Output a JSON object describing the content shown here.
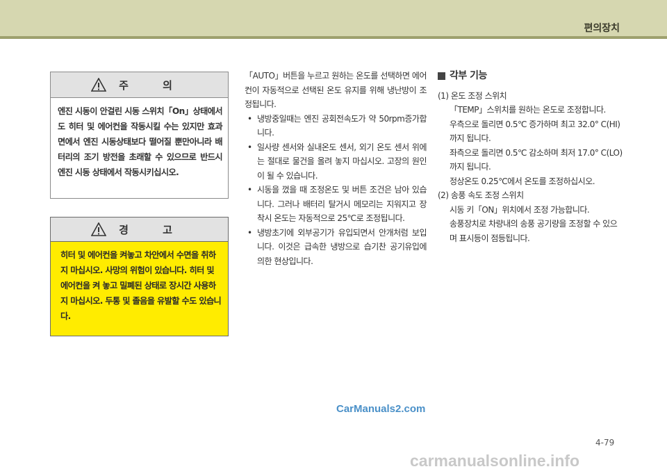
{
  "header": {
    "title": "편의장치"
  },
  "caution": {
    "title": "주 의",
    "body": "엔진 시동이 안걸린 시동 스위치「On」상태에서도 히터 및 에어컨을 작동시킬 수는 있지만 효과면에서 엔진 시동상태보다 떨어질 뿐만아니라 배터리의 조기 방전을 초래할 수 있으므로 반드시 엔진 시동 상태에서 작동시키십시오."
  },
  "warning": {
    "title": "경 고",
    "body": "히터 및 에어컨을 켜놓고 차안에서 수면을 취하지 마십시오. 사망의 위험이 있습니다. 히터 및 에어컨을 켜 놓고 밀폐된 상태로 장시간 사용하지 마십시오. 두통 및 졸음을 유발할 수도 있습니다."
  },
  "middle": {
    "intro": "「AUTO」버튼을 누르고 원하는 온도를 선택하면 에어컨이 자동적으로 선택된 온도 유지를 위해 냉난방이 조정됩니다.",
    "bullets": [
      "냉방중일때는 엔진 공회전속도가 약 50rpm증가합니다.",
      "일사량 센서와 실내온도 센서, 외기 온도 센서 위에는 절대로 물건을 올려 놓지 마십시오. 고장의 원인이 될 수 있습니다.",
      "시동을 껐을 때 조정온도 및 버튼 조건은 남아 있습니다. 그러나 배터리 탈거시 메모리는 지워지고 장착시 온도는 자동적으로 25℃로 조정됩니다.",
      "냉방초기에 외부공기가 유입되면서 안개처럼 보입니다. 이것은 급속한 냉방으로 습기찬 공기유입에 의한 현상입니다."
    ]
  },
  "right": {
    "section_title": "각부 기능",
    "item1_title": "(1) 온도 조정 스위치",
    "item1_lines": [
      "「TEMP」스위치를 원하는 온도로 조정합니다.",
      "우측으로 돌리면 0.5℃ 증가하며 최고 32.0° C(HI)까지 됩니다.",
      "좌측으로 돌리면 0.5℃ 감소하며 최저 17.0° C(LO)까지 됩니다.",
      "정상온도 0.25℃에서 온도를 조정하십시오."
    ],
    "item2_title": "(2) 송풍 속도 조정 스위치",
    "item2_line1": "시동 키「ON」위치에서 조정 가능합니다.",
    "item2_line2": "송풍장치로 차량내의 송풍 공기량을 조정할 수 있으며 표시등이 점등됩니다."
  },
  "watermark": "CarManuals2.com",
  "page_number": "4-79",
  "footer_logo": "carmanualsonline.info"
}
